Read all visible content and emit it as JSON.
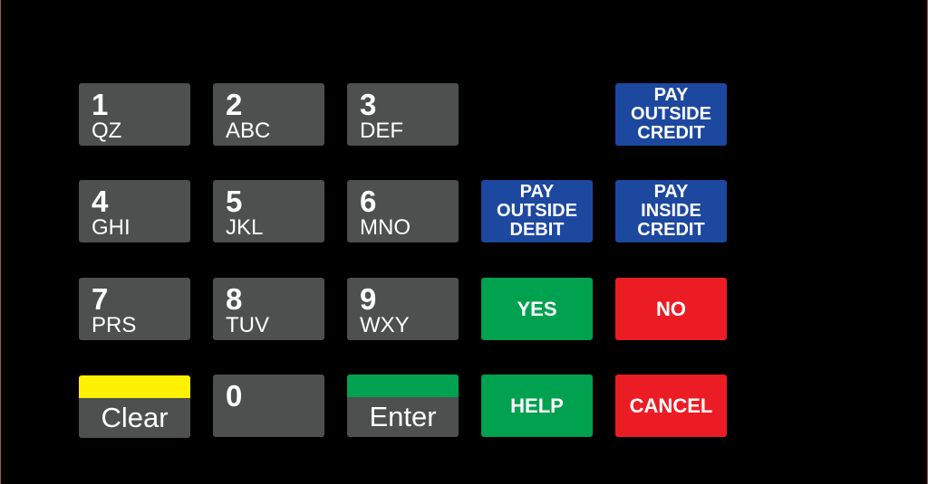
{
  "keypad": {
    "numeric_keys": [
      {
        "digit": "1",
        "letters": "QZ"
      },
      {
        "digit": "2",
        "letters": "ABC"
      },
      {
        "digit": "3",
        "letters": "DEF"
      },
      {
        "digit": "4",
        "letters": "GHI"
      },
      {
        "digit": "5",
        "letters": "JKL"
      },
      {
        "digit": "6",
        "letters": "MNO"
      },
      {
        "digit": "7",
        "letters": "PRS"
      },
      {
        "digit": "8",
        "letters": "TUV"
      },
      {
        "digit": "9",
        "letters": "WXY"
      },
      {
        "digit": "0",
        "letters": ""
      }
    ],
    "clear": {
      "label": "Clear",
      "accent": "#fff200"
    },
    "enter": {
      "label": "Enter",
      "accent": "#00a14f"
    },
    "pay_outside_credit": {
      "label": "PAY\nOUTSIDE\nCREDIT"
    },
    "pay_outside_debit": {
      "label": "PAY\nOUTSIDE\nDEBIT"
    },
    "pay_inside_credit": {
      "label": "PAY\nINSIDE\nCREDIT"
    },
    "yes": {
      "label": "YES"
    },
    "no": {
      "label": "NO"
    },
    "help": {
      "label": "HELP"
    },
    "cancel": {
      "label": "CANCEL"
    },
    "colors": {
      "key_gray": "#4e4f4f",
      "blue": "#1d48a0",
      "green": "#00a14f",
      "red": "#ec1c24",
      "yellow": "#fff200",
      "background": "#000000"
    }
  }
}
